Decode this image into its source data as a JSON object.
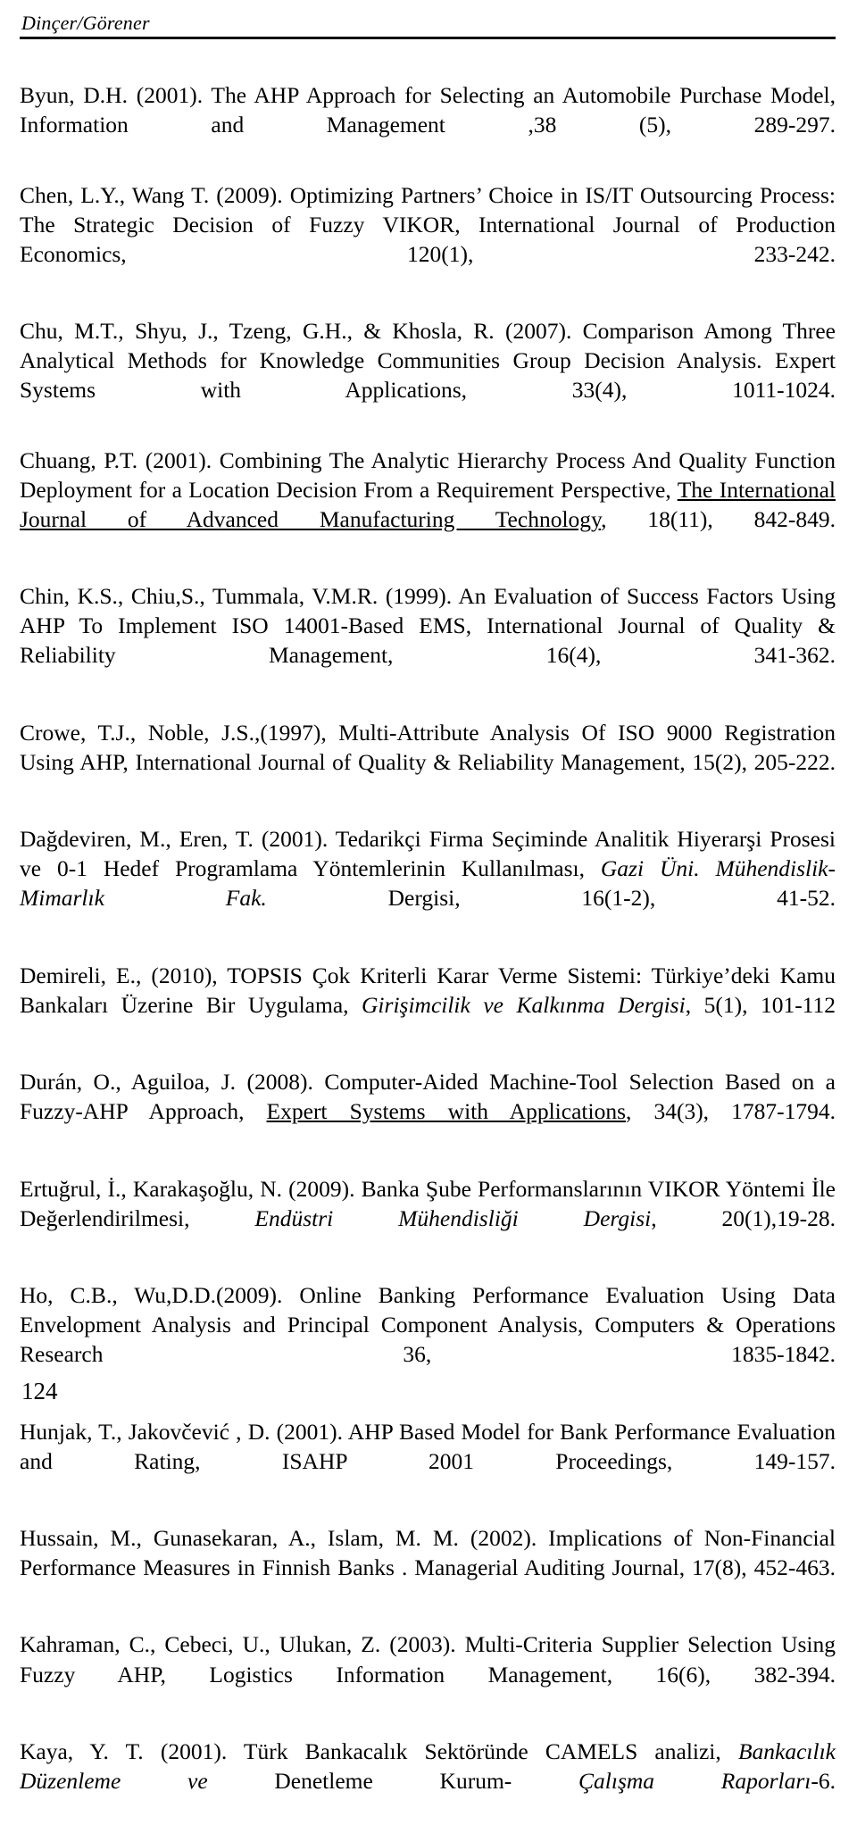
{
  "header": {
    "running_head": "Dinçer/Görener"
  },
  "footer": {
    "page_number": "124"
  },
  "references": [
    {
      "id": "byun-2001",
      "segments": [
        {
          "text": "Byun, D.H. (2001). The AHP Approach for Selecting an Automobile Purchase Model, Information and Management ,38 (5), 289-297.",
          "style": "normal"
        }
      ]
    },
    {
      "id": "chen-wang-2009",
      "segments": [
        {
          "text": "Chen, L.Y., Wang T. (2009). Optimizing Partners’ Choice in IS/IT Outsourcing Process: The Strategic Decision of Fuzzy VIKOR,  International Journal of  Production Economics, 120(1), 233-242.",
          "style": "normal"
        }
      ]
    },
    {
      "id": "chu-2007",
      "segments": [
        {
          "text": "Chu, M.T., Shyu, J., Tzeng, G.H., & Khosla, R. (2007). Comparison Among Three Analytical Methods for Knowledge Communities Group Decision Analysis. Expert Systems with Applications, 33(4), 1011-1024.",
          "style": "normal"
        }
      ]
    },
    {
      "id": "chuang-2001",
      "segments": [
        {
          "text": "Chuang, P.T. (2001). Combining The Analytic Hierarchy Process And Quality Function Deployment for a Location Decision From a Requirement Perspective, ",
          "style": "normal"
        },
        {
          "text": "The International Journal of Advanced Manufacturing Technology",
          "style": "underline"
        },
        {
          "text": ", 18(11), 842-849.",
          "style": "normal"
        }
      ]
    },
    {
      "id": "chin-1999",
      "segments": [
        {
          "text": "Chin, K.S., Chiu,S., Tummala, V.M.R. (1999). An Evaluation of Success Factors Using AHP To Implement ISO 14001-Based EMS, International Journal of Quality & Reliability Management, 16(4), 341-362.",
          "style": "normal"
        }
      ]
    },
    {
      "id": "crowe-noble-1997",
      "segments": [
        {
          "text": "Crowe, T.J.,  Noble, J.S.,(1997), Multi-Attribute Analysis Of ISO 9000 Registration Using AHP, International Journal of Quality & Reliability Management, 15(2), 205-222.",
          "style": "normal"
        }
      ]
    },
    {
      "id": "dagdeviren-eren-2001",
      "segments": [
        {
          "text": "Dağdeviren, M., Eren, T. (2001).  Tedarikçi Firma Seçiminde Analitik Hiyerarşi Prosesi ve 0-1 Hedef Programlama Yöntemlerinin Kullanılması, ",
          "style": "normal"
        },
        {
          "text": "Gazi Üni. Mühendislik-Mimarlık Fak.",
          "style": "italic"
        },
        {
          "text": " Dergisi, 16(1-2), 41-52.",
          "style": "normal"
        }
      ]
    },
    {
      "id": "demireli-2010",
      "segments": [
        {
          "text": "Demireli, E., (2010), TOPSIS Çok Kriterli Karar Verme Sistemi: Türkiye’deki Kamu Bankaları Üzerine Bir Uygulama, ",
          "style": "normal"
        },
        {
          "text": "Girişimcilik ve Kalkınma Dergisi",
          "style": "italic"
        },
        {
          "text": ", 5(1), 101-112",
          "style": "normal"
        }
      ]
    },
    {
      "id": "duran-aguiloa-2008",
      "segments": [
        {
          "text": "Durán, O., Aguiloa, J. (2008). Computer-Aided Machine-Tool Selection Based on a Fuzzy-AHP Approach, ",
          "style": "normal"
        },
        {
          "text": "Expert Systems with Applications",
          "style": "underline"
        },
        {
          "text": ", 34(3), 1787-1794.",
          "style": "normal"
        }
      ]
    },
    {
      "id": "ertugrul-2009",
      "segments": [
        {
          "text": "Ertuğrul, İ., Karakaşoğlu, N. (2009). Banka Şube Performanslarının VIKOR Yöntemi İle Değerlendirilmesi, ",
          "style": "normal"
        },
        {
          "text": "Endüstri Mühendisliği Dergisi",
          "style": "italic"
        },
        {
          "text": ", 20(1),19-28.",
          "style": "normal"
        }
      ]
    },
    {
      "id": "ho-wu-2009",
      "segments": [
        {
          "text": "Ho, C.B., Wu,D.D.(2009). Online Banking Performance Evaluation Using Data Envelopment Analysis and Principal Component Analysis, Computers & Operations Research 36, 1835-1842.",
          "style": "normal"
        }
      ]
    },
    {
      "id": "hunjak-2001",
      "segments": [
        {
          "text": "Hunjak, T.,  Jakovčević , D. (2001).  AHP Based Model for Bank Performance  Evaluation and Rating, ISAHP 2001 Proceedings, 149-157.",
          "style": "normal"
        }
      ]
    },
    {
      "id": "hussain-2002",
      "segments": [
        {
          "text": "Hussain, M., Gunasekaran, A., Islam, M. M. (2002). Implications of Non-Financial Performance Measures in Finnish Banks . Managerial Auditing Journal, 17(8), 452-463.",
          "style": "normal"
        }
      ]
    },
    {
      "id": "kahraman-2003",
      "segments": [
        {
          "text": "Kahraman, C., Cebeci, U.,  Ulukan, Z. (2003). Multi-Criteria Supplier Selection Using Fuzzy AHP, Logistics Information Management, 16(6), 382-394.",
          "style": "normal"
        }
      ]
    },
    {
      "id": "kaya-2001",
      "segments": [
        {
          "text": "Kaya, Y. T. (2001).  Türk Bankacalık Sektöründe CAMELS analizi, ",
          "style": "normal"
        },
        {
          "text": "Bankacılık Düzenleme ve",
          "style": "italic"
        },
        {
          "text": " Denetleme Kurum- ",
          "style": "normal"
        },
        {
          "text": "Çalışma Raporları",
          "style": "italic"
        },
        {
          "text": "-6.",
          "style": "normal"
        }
      ]
    }
  ]
}
